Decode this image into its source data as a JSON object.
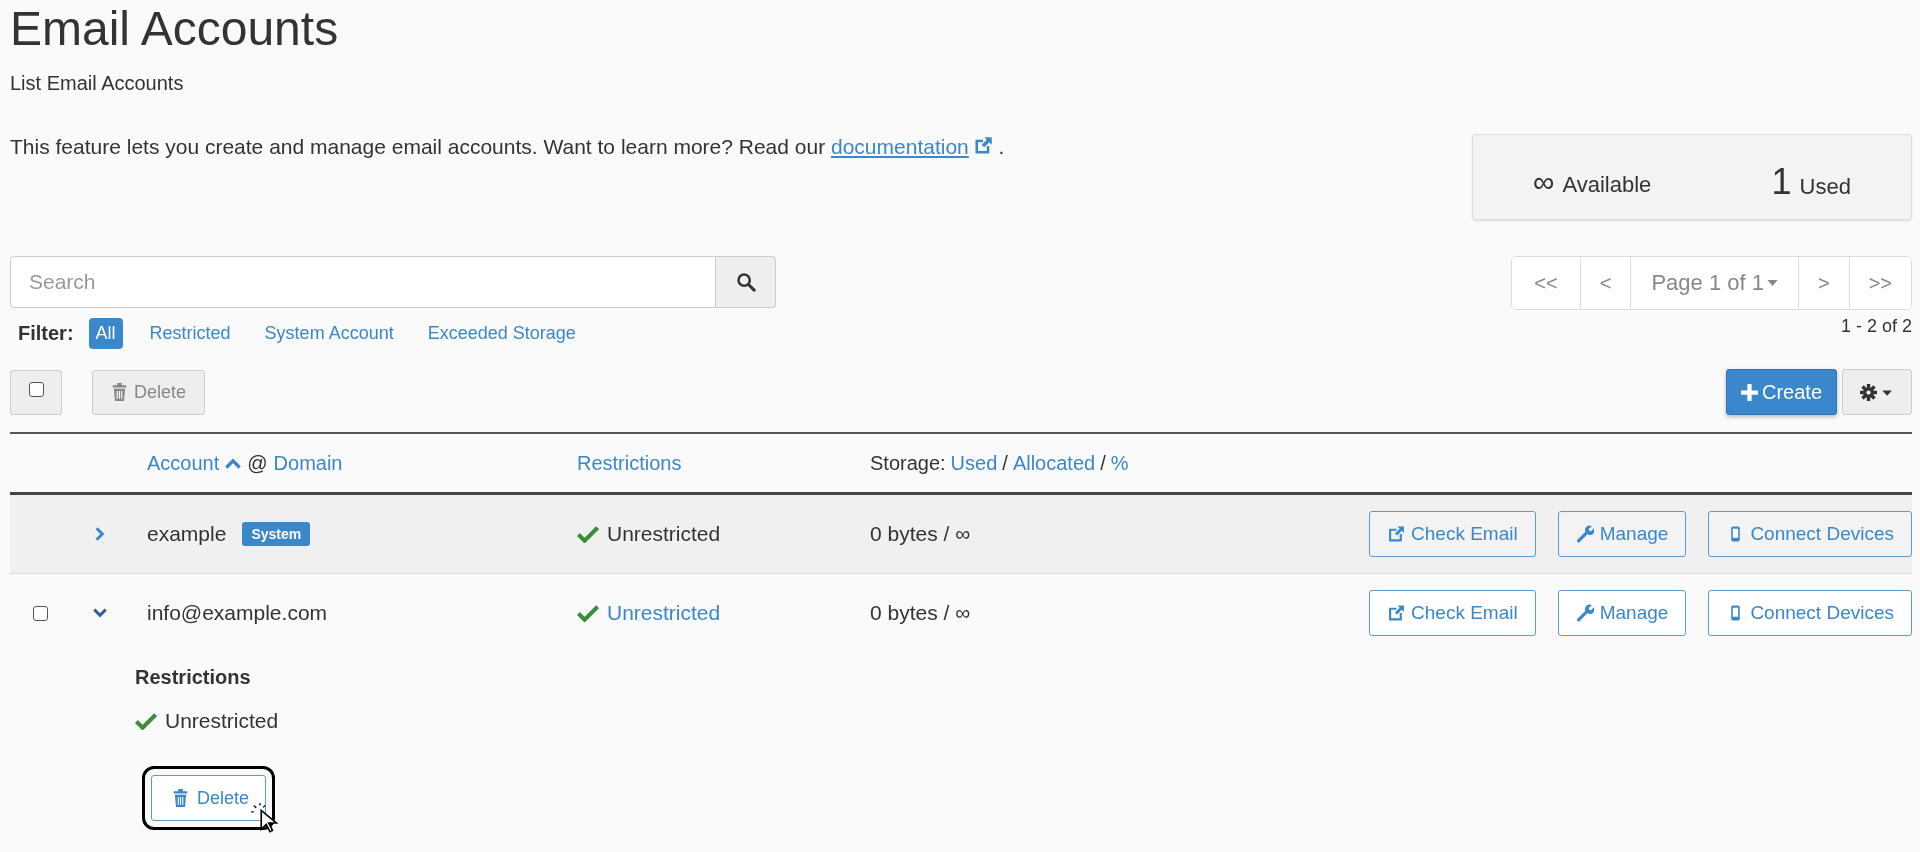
{
  "page": {
    "title": "Email Accounts",
    "subtitle": "List Email Accounts"
  },
  "description": {
    "text": "This feature lets you create and manage email accounts. Want to learn more? Read our",
    "link": "documentation",
    "after": "."
  },
  "stats": [
    {
      "value": "∞",
      "label": "Available"
    },
    {
      "value": "1",
      "label": "Used"
    }
  ],
  "search": {
    "placeholder": "Search"
  },
  "pagination": {
    "first": "<<",
    "prev": "<",
    "page": "Page 1 of 1",
    "next": ">",
    "last": ">>",
    "range": "1 - 2 of 2"
  },
  "filter": {
    "label": "Filter:",
    "options": [
      {
        "label": "All",
        "selected": true
      },
      {
        "label": "Restricted",
        "selected": false
      },
      {
        "label": "System Account",
        "selected": false
      },
      {
        "label": "Exceeded Storage",
        "selected": false
      }
    ]
  },
  "toolbar": {
    "select_all_checked": false,
    "delete": "Delete",
    "delete_disabled": true,
    "create": "Create"
  },
  "columns": {
    "account": "Account",
    "at": "@",
    "domain": "Domain",
    "restrictions": "Restrictions",
    "storage": "Storage:",
    "used": "Used",
    "sep1": "/",
    "allocated": "Allocated",
    "sep2": "/",
    "percent": "%"
  },
  "rows": [
    {
      "account": "example",
      "badge": "System",
      "expanded": false,
      "highlighted": true,
      "restriction": "Unrestricted",
      "restriction_link": false,
      "storage": "0 bytes / ∞",
      "actions": [
        {
          "kind": "external",
          "label": "Check Email"
        },
        {
          "kind": "wrench",
          "label": "Manage"
        },
        {
          "kind": "phone",
          "label": "Connect Devices"
        }
      ]
    },
    {
      "account": "info@example.com",
      "expanded": true,
      "highlighted": false,
      "checked": false,
      "restriction": "Unrestricted",
      "restriction_link": true,
      "storage": "0 bytes / ∞",
      "actions": [
        {
          "kind": "external",
          "label": "Check Email"
        },
        {
          "kind": "wrench",
          "label": "Manage"
        },
        {
          "kind": "phone",
          "label": "Connect Devices"
        }
      ],
      "detail": {
        "heading": "Restrictions",
        "status": "Unrestricted",
        "delete": "Delete",
        "delete_focused": true
      }
    }
  ]
}
